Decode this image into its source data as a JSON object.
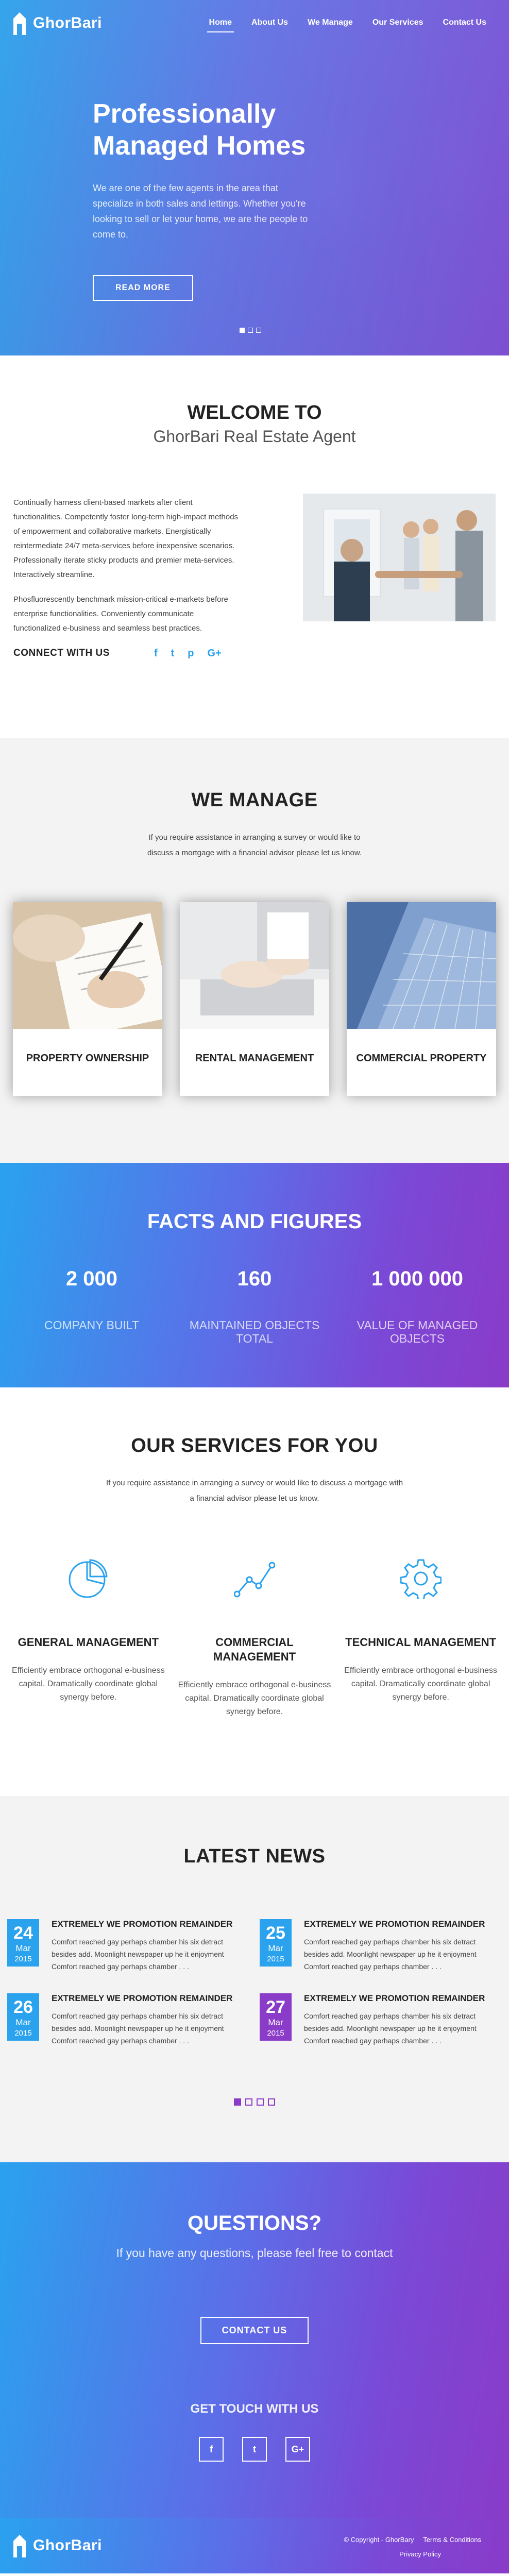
{
  "brand": {
    "name": "GhorBari"
  },
  "nav": {
    "items": [
      {
        "label": "Home"
      },
      {
        "label": "About Us"
      },
      {
        "label": "We Manage"
      },
      {
        "label": "Our Services"
      },
      {
        "label": "Contact Us"
      }
    ]
  },
  "hero": {
    "title": "Professionally Managed Homes",
    "text": "We are one of the few agents in the area that specialize in both sales and lettings. Whether you're looking to sell or let your home, we are the people to come to.",
    "button": "READ MORE"
  },
  "welcome": {
    "title": "WELCOME TO",
    "subtitle": "GhorBari Real Estate Agent",
    "para1": "Continually harness client-based markets after client functionalities. Competently foster long-term high-impact methods of empowerment and collaborative markets. Energistically reintermediate 24/7 meta-services before inexpensive scenarios. Professionally iterate sticky products and premier meta-services. Interactively streamline.",
    "para2": "Phosfluorescently benchmark mission-critical e-markets before enterprise functionalities. Conveniently communicate functionalized e-business and seamless best practices.",
    "connect_label": "CONNECT WITH US",
    "socials": [
      "f",
      "t",
      "p",
      "G+"
    ]
  },
  "manage": {
    "title": "WE MANAGE",
    "text": "If you require assistance in arranging a survey or would like to discuss a mortgage with a financial advisor please let us know.",
    "cards": [
      {
        "label": "PROPERTY OWNERSHIP"
      },
      {
        "label": "RENTAL MANAGEMENT"
      },
      {
        "label": "COMMERCIAL PROPERTY"
      }
    ]
  },
  "facts": {
    "title": "FACTS AND FIGURES",
    "items": [
      {
        "value": "2 000",
        "label": "COMPANY BUILT"
      },
      {
        "value": "160",
        "label": "MAINTAINED OBJECTS TOTAL"
      },
      {
        "value": "1 000 000",
        "label": "VALUE OF MANAGED OBJECTS"
      }
    ]
  },
  "services": {
    "title": "OUR SERVICES FOR YOU",
    "text": "If you require assistance in arranging a survey or would like to discuss a mortgage with a financial advisor please let us know.",
    "items": [
      {
        "name": "GENERAL MANAGEMENT",
        "text": "Efficiently embrace orthogonal e-business capital. Dramatically coordinate global synergy before.",
        "icon": "pie-chart-icon"
      },
      {
        "name": "COMMERCIAL MANAGEMENT",
        "text": "Efficiently embrace orthogonal e-business capital. Dramatically coordinate global synergy before.",
        "icon": "line-chart-icon"
      },
      {
        "name": "TECHNICAL MANAGEMENT",
        "text": "Efficiently embrace orthogonal e-business capital. Dramatically coordinate global synergy before.",
        "icon": "gear-icon"
      }
    ]
  },
  "news": {
    "title": "LATEST NEWS",
    "items": [
      {
        "day": "24",
        "month": "Mar",
        "year": "2015",
        "title": "EXTREMELY WE PROMOTION REMAINDER",
        "text": "Comfort reached gay perhaps chamber his six detract besides add. Moonlight newspaper up he it enjoyment Comfort reached gay perhaps chamber . . .",
        "color": "#2aa2ee"
      },
      {
        "day": "25",
        "month": "Mar",
        "year": "2015",
        "title": "EXTREMELY WE PROMOTION REMAINDER",
        "text": "Comfort reached gay perhaps chamber his six detract besides add. Moonlight newspaper up he it enjoyment Comfort reached gay perhaps chamber . . .",
        "color": "#2aa2ee"
      },
      {
        "day": "26",
        "month": "Mar",
        "year": "2015",
        "title": "EXTREMELY WE PROMOTION REMAINDER",
        "text": "Comfort reached gay perhaps chamber his six detract besides add. Moonlight newspaper up he it enjoyment Comfort reached gay perhaps chamber . . .",
        "color": "#2aa2ee"
      },
      {
        "day": "27",
        "month": "Mar",
        "year": "2015",
        "title": "EXTREMELY WE PROMOTION REMAINDER",
        "text": "Comfort reached gay perhaps chamber his six detract besides add. Moonlight newspaper up he it enjoyment Comfort reached gay perhaps chamber . . .",
        "color": "#8a3bc8"
      }
    ]
  },
  "questions": {
    "title": "QUESTIONS?",
    "text": "If you have any questions, please feel free to contact",
    "button": "CONTACT US",
    "touch_title": "GET TOUCH WITH US",
    "socials": [
      "f",
      "t",
      "G+"
    ]
  },
  "footer": {
    "copyright": "© Copyright - GhorBary",
    "terms": "Terms & Conditions",
    "privacy": "Privacy Policy"
  },
  "colors": {
    "accent": "#2aa2ee",
    "purple": "#8a3bc8"
  }
}
